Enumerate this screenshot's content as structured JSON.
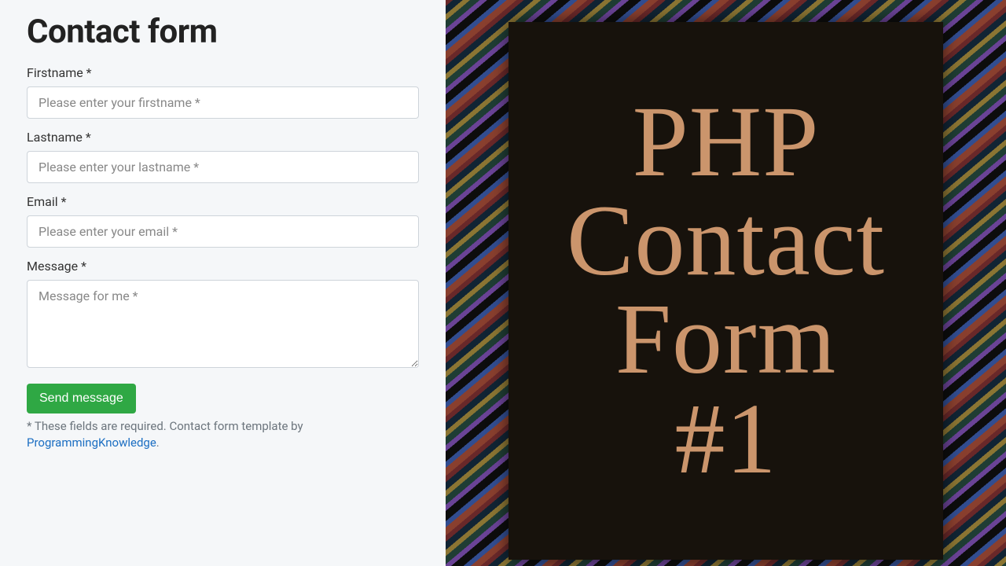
{
  "form": {
    "title": "Contact form",
    "fields": {
      "firstname": {
        "label": "Firstname *",
        "placeholder": "Please enter your firstname *"
      },
      "lastname": {
        "label": "Lastname *",
        "placeholder": "Please enter your lastname *"
      },
      "email": {
        "label": "Email *",
        "placeholder": "Please enter your email *"
      },
      "message": {
        "label": "Message *",
        "placeholder": "Message for me *"
      }
    },
    "submit_label": "Send message",
    "footer_text": "* These fields are required. Contact form template by ",
    "footer_link_text": "ProgrammingKnowledge",
    "footer_period": "."
  },
  "banner": {
    "line1": "PHP",
    "line2": "Contact",
    "line3": "Form",
    "line4": "#1"
  }
}
